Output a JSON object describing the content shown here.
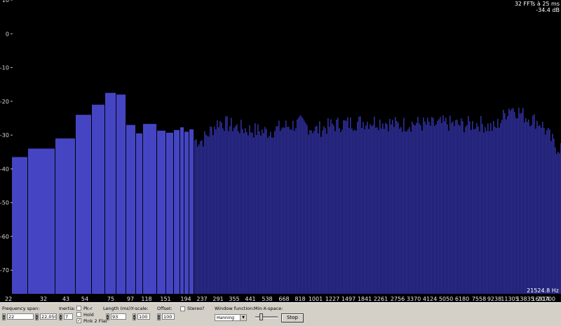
{
  "info": {
    "ffts": "32 FFTs à 25 ms",
    "level": "-34.4 dB",
    "freq_readout": "21524.8 Hz"
  },
  "controls": {
    "frequency_span_label": "Frequency span:",
    "freq_from": "22",
    "freq_to": "22,050",
    "inertia_label": "Inertia:",
    "inertia_value": "7",
    "pk_r_label": "Pk-r",
    "hold_label": "Hold",
    "pink2flat_label": "Pink 2 Flat",
    "pink2flat_checked": "✓",
    "length_label": "Length (ms):",
    "length_value": "93",
    "yscale_label": "Y-scale:",
    "yscale_value": "100",
    "offset_label": "Offset:",
    "offset_value": "100",
    "stereo_label": "Stereo?",
    "window_function_label": "Window function:",
    "window_function_value": "Hanning",
    "min_x_space_label": "Min-X-space:",
    "stop_label": "Stop"
  },
  "colors": {
    "bar": "#4545c4",
    "bar_dense": "#2f2f9c",
    "background": "#000000",
    "panel": "#d4d0c8"
  },
  "chart_data": {
    "type": "bar",
    "ylabel": "",
    "xlabel": "",
    "ylim": [
      -77,
      10
    ],
    "y_ticks": [
      "10",
      "0",
      "-10",
      "-20",
      "-30",
      "-40",
      "-50",
      "-60",
      "-70"
    ],
    "y_tick_values": [
      10,
      0,
      -10,
      -20,
      -30,
      -40,
      -50,
      -60,
      -70
    ],
    "x_tick_labels": [
      "22",
      "32",
      "43",
      "54",
      "75",
      "97",
      "118",
      "151",
      "194",
      "237",
      "291",
      "355",
      "441",
      "538",
      "668",
      "818",
      "1001",
      "1227",
      "1497",
      "1841",
      "2261",
      "2756",
      "3370",
      "4124",
      "5050",
      "6180",
      "7558",
      "9238",
      "11305",
      "13835",
      "16914",
      "20700"
    ],
    "x_tick_frequencies_hz": [
      22,
      32,
      43,
      54,
      75,
      97,
      118,
      151,
      194,
      237,
      291,
      355,
      441,
      538,
      668,
      818,
      1001,
      1227,
      1497,
      1841,
      2261,
      2756,
      3370,
      4124,
      5050,
      6180,
      7558,
      9238,
      11305,
      13835,
      16914,
      20700
    ],
    "grid": false,
    "wide_bars_db": [
      -36.5,
      -34,
      -31,
      -24,
      -21,
      -17.5,
      -18,
      -27,
      -29.5,
      -26.7,
      -28.7,
      -29.3,
      -28.5,
      -27.7,
      -29,
      -28.3
    ],
    "dense_profile": {
      "positions_hz": [
        237,
        291,
        355,
        441,
        538,
        668,
        818,
        1001,
        1227,
        1497,
        1841,
        2261,
        2756,
        3370,
        4124,
        5050,
        6180,
        7558,
        9238,
        11305,
        13835,
        16914,
        20700
      ],
      "base_db": [
        -31.5,
        -26,
        -27.5,
        -28.5,
        -29,
        -27.5,
        -26.5,
        -28.5,
        -27,
        -26.5,
        -26,
        -26,
        -27,
        -26.5,
        -27,
        -26.5,
        -27,
        -26.5,
        -28,
        -21.5,
        -24.5,
        -26.5,
        -33.5
      ]
    }
  }
}
